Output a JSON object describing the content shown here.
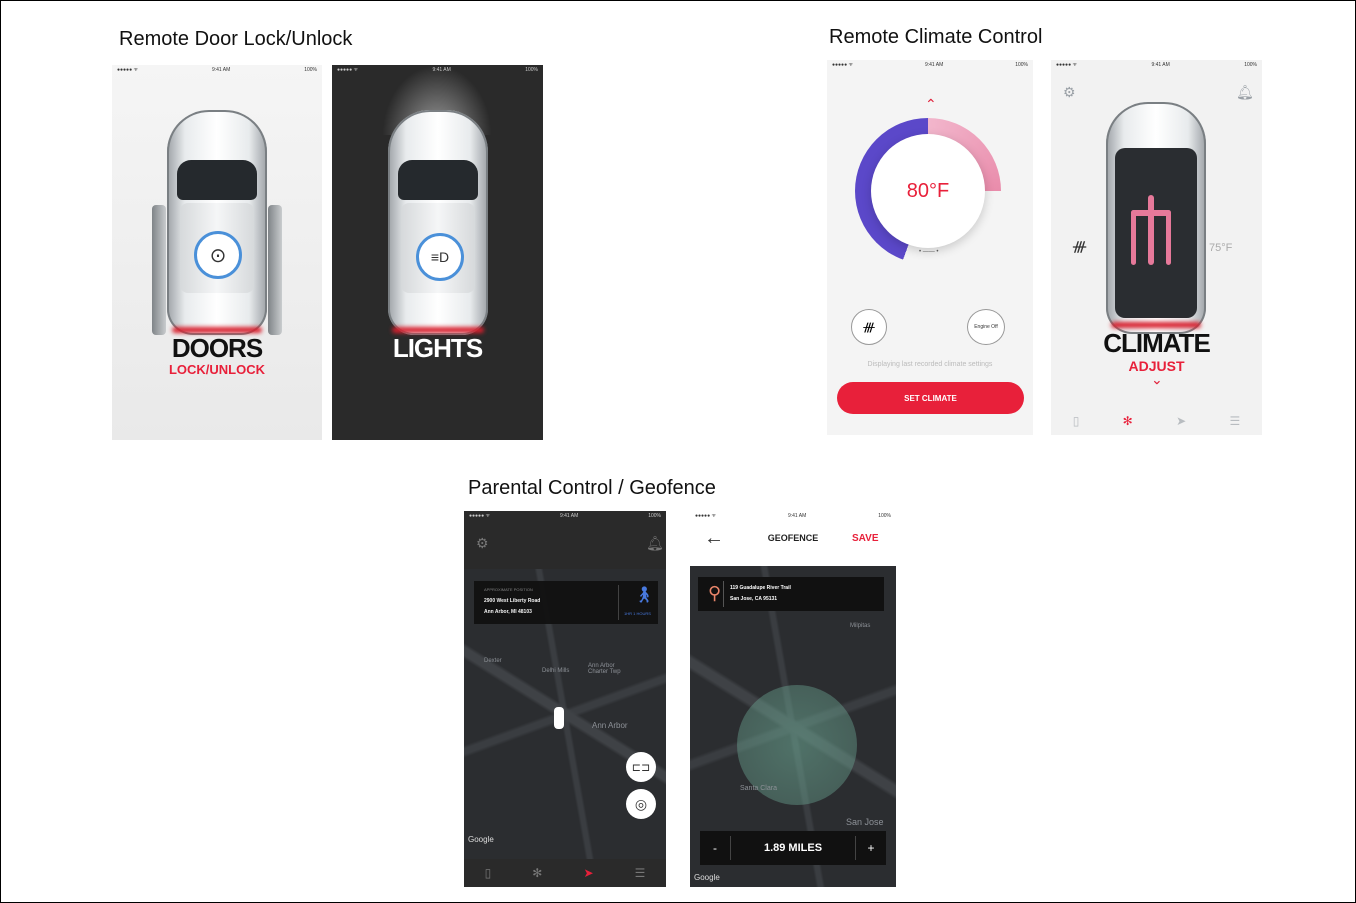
{
  "sections": {
    "doors_title": "Remote Door Lock/Unlock",
    "climate_title": "Remote Climate Control",
    "parental_title": "Parental Control / Geofence"
  },
  "status_bar": {
    "carrier": "●●●●● ᯤ",
    "time": "9:41 AM",
    "battery": "100%"
  },
  "doors_screen": {
    "label": "DOORS",
    "sublabel": "LOCK/UNLOCK",
    "icon": "lock-open-icon"
  },
  "lights_screen": {
    "label": "LIGHTS",
    "icon": "headlight-icon"
  },
  "climate_screen": {
    "temperature": "80°F",
    "defrost_icon": "rear-defrost-icon",
    "engine_button": "Engine Off",
    "info_text": "Displaying last recorded climate settings",
    "set_button": "SET CLIMATE"
  },
  "climate_car_screen": {
    "label": "CLIMATE",
    "sublabel": "ADJUST",
    "cabin_temp": "75°F"
  },
  "position_screen": {
    "heading": "APPROXIMATE POSITION",
    "address_line1": "2900 West Liberty Road",
    "address_line2": "Ann Arbor, MI 48103",
    "walk_time": "1HR 1 HOURS",
    "map_labels": [
      "Dexter",
      "Delhi Mills",
      "Ann Arbor Charter Twp",
      "Ann Arbor"
    ],
    "attribution": "Google"
  },
  "geofence_screen": {
    "title": "GEOFENCE",
    "save": "SAVE",
    "address_line1": "119 Guadalupe River Trail",
    "address_line2": "San Jose, CA 95131",
    "map_labels": [
      "Milpitas",
      "Santa Clara",
      "San Jose"
    ],
    "radius": "1.89 MILES",
    "minus": "-",
    "plus": "+",
    "attribution": "Google"
  },
  "colors": {
    "accent": "#e8203a",
    "blue": "#4a90d9",
    "dark_bg": "#2a2a2a",
    "light_bg": "#f2f2f2"
  }
}
